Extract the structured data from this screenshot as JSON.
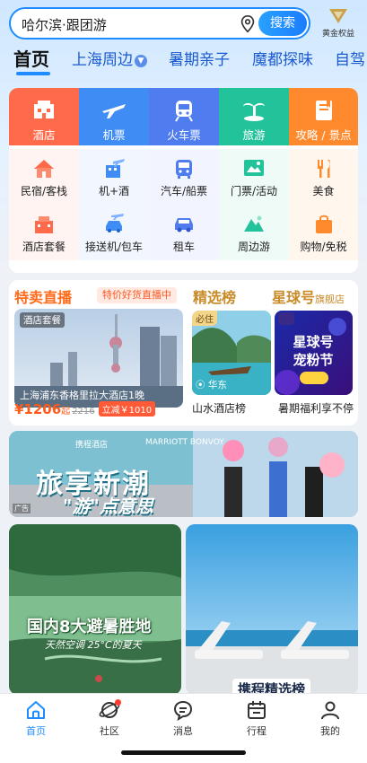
{
  "search": {
    "text": "哈尔滨·跟团游",
    "button": "搜索"
  },
  "gold": {
    "label": "黄金权益"
  },
  "tabs": [
    "首页",
    "上海周边",
    "暑期亲子",
    "魔都探味",
    "自驾"
  ],
  "categories": [
    {
      "label": "酒店",
      "color": "#ff6a4a",
      "icon": "hotel-icon"
    },
    {
      "label": "机票",
      "color": "#3f8cf5",
      "icon": "plane-icon"
    },
    {
      "label": "火车票",
      "color": "#4f7df0",
      "icon": "train-icon"
    },
    {
      "label": "旅游",
      "color": "#22c29a",
      "icon": "palm-tree-icon"
    },
    {
      "label": "攻略 / 景点",
      "color": "#ff8a2e",
      "icon": "guide-book-icon"
    }
  ],
  "sub_row1": [
    "民宿/客栈",
    "机+酒",
    "汽车/船票",
    "门票/活动",
    "美食"
  ],
  "sub_row2": [
    "酒店套餐",
    "接送机/包车",
    "租车",
    "周边游",
    "购物/免税"
  ],
  "live": {
    "title": "特卖直播",
    "tag": "特价好货直播中",
    "badge": "酒店套餐",
    "hotel": "上海浦东香格里拉大酒店1晚",
    "price": "¥1206",
    "price_suffix": "起",
    "old_price": "2216",
    "cut": "立减￥1010"
  },
  "selection": {
    "title": "精选榜",
    "star_title": "星球号",
    "star_sub": "旗舰店",
    "must": "必住",
    "location": "华东",
    "cap1": "山水酒店榜",
    "cap2": "暑期福利享不停",
    "poster_line1": "星球号",
    "poster_line2": "宠粉节"
  },
  "ad": {
    "tag": "广告",
    "title": "旅享新潮",
    "sub": "\"游\"点意思",
    "brand1": "携程酒店",
    "brand2": "MARRIOTT BONVOY"
  },
  "feed": {
    "title1": "国内8大避暑胜地",
    "sub1": "天然空调 25°C的夏天",
    "title2": "携程精选榜"
  },
  "nav": [
    {
      "label": "首页",
      "icon": "home-icon",
      "active": true
    },
    {
      "label": "社区",
      "icon": "community-planet-icon"
    },
    {
      "label": "消息",
      "icon": "message-icon"
    },
    {
      "label": "行程",
      "icon": "trip-calendar-icon"
    },
    {
      "label": "我的",
      "icon": "profile-icon"
    }
  ],
  "colors": {
    "accent": "#1e8cff",
    "live_orange": "#ff6b1a",
    "gold": "#c98a28"
  }
}
